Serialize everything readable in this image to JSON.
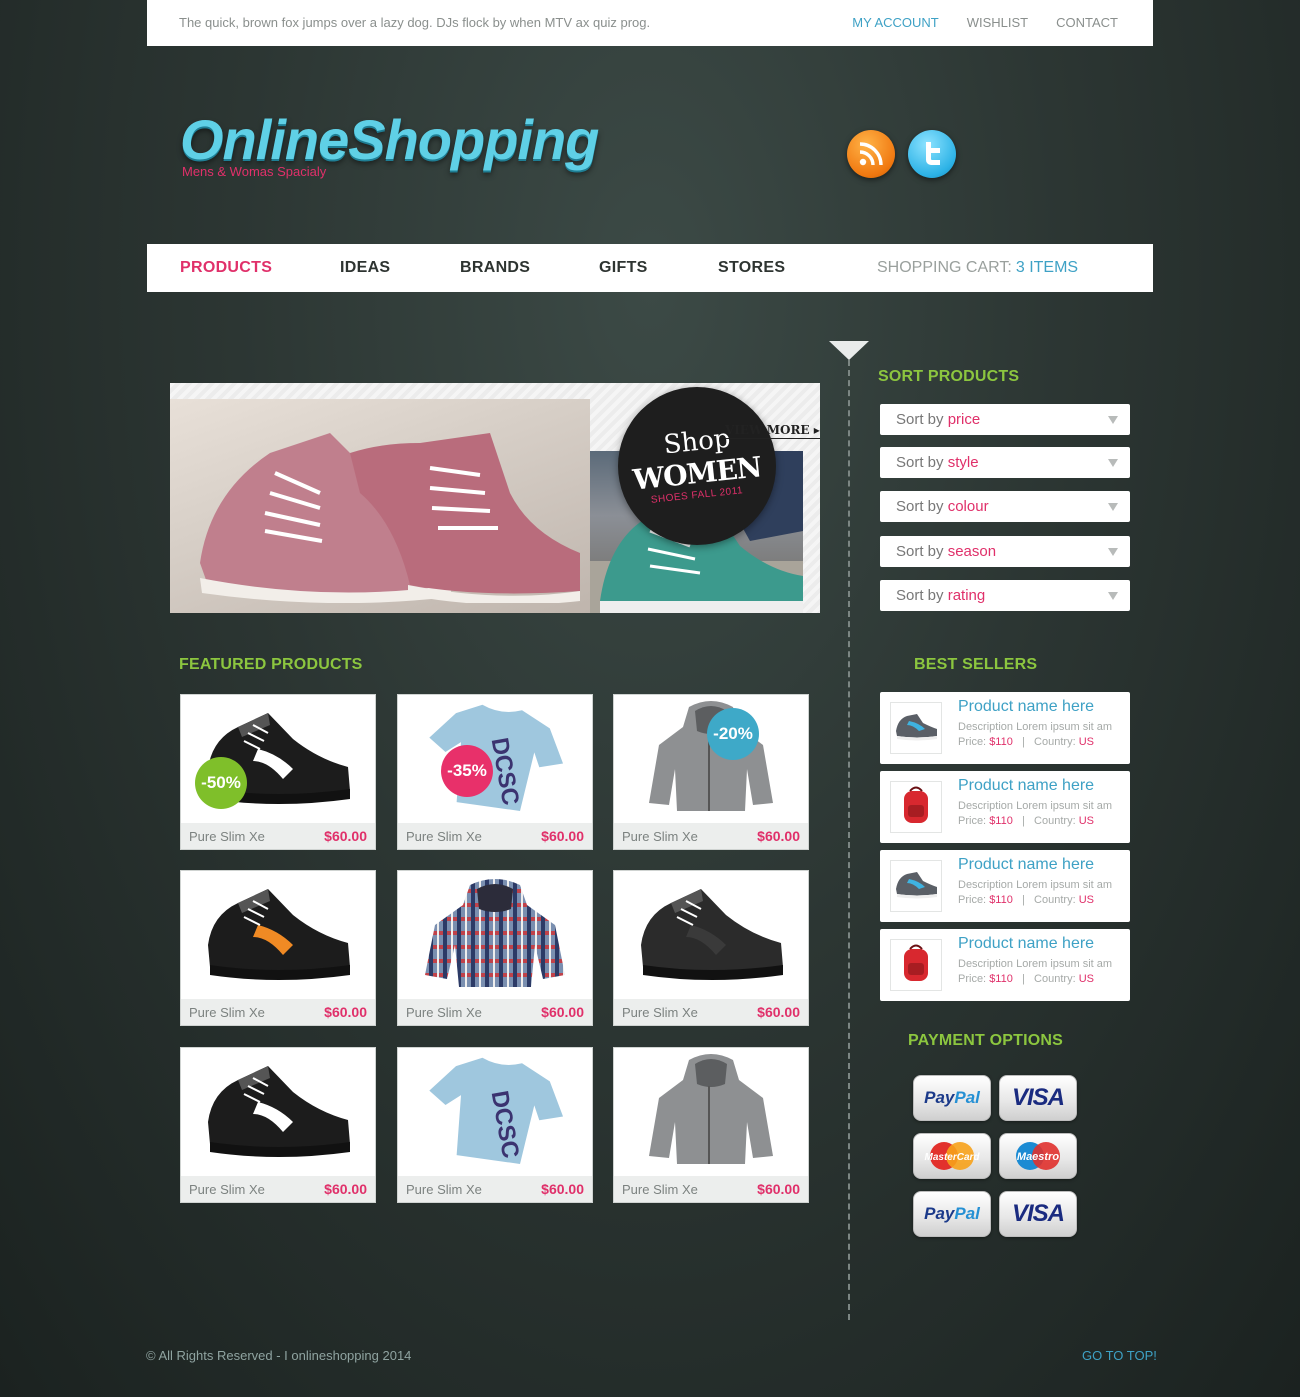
{
  "topbar": {
    "tagline": "The quick, brown fox jumps over a lazy dog. DJs flock by when MTV ax quiz prog.",
    "links": [
      "MY ACCOUNT",
      "WISHLIST",
      "CONTACT"
    ]
  },
  "logo": {
    "name": "OnlineShopping",
    "subtitle": "Mens & Womas Spacialy"
  },
  "nav": {
    "items": [
      "PRODUCTS",
      "IDEAS",
      "BRANDS",
      "GIFTS",
      "STORES"
    ],
    "cart_label": "SHOPPING CART:",
    "cart_count": "3 ITEMS"
  },
  "banner": {
    "line1": "Shop",
    "line2": "WOMEN",
    "line3": "SHOES FALL 2011",
    "view_more": "VIEW MORE"
  },
  "featured": {
    "title": "FEATURED PRODUCTS",
    "products": [
      {
        "name": "Pure Slim Xe",
        "price": "$60.00",
        "badge": "-50%",
        "icon": "sneaker-black-icon"
      },
      {
        "name": "Pure Slim Xe",
        "price": "$60.00",
        "badge": "-35%",
        "icon": "tshirt-blue-icon"
      },
      {
        "name": "Pure Slim Xe",
        "price": "$60.00",
        "badge": "-20%",
        "icon": "hoodie-grey-icon"
      },
      {
        "name": "Pure Slim Xe",
        "price": "$60.00",
        "icon": "sneaker-orange-icon"
      },
      {
        "name": "Pure Slim Xe",
        "price": "$60.00",
        "icon": "hoodie-plaid-icon"
      },
      {
        "name": "Pure Slim Xe",
        "price": "$60.00",
        "icon": "sneaker-dark-icon"
      },
      {
        "name": "Pure Slim Xe",
        "price": "$60.00",
        "icon": "sneaker-black-icon"
      },
      {
        "name": "Pure Slim Xe",
        "price": "$60.00",
        "icon": "tshirt-blue-icon"
      },
      {
        "name": "Pure Slim Xe",
        "price": "$60.00",
        "icon": "hoodie-grey-icon"
      }
    ],
    "badge_colors": {
      "-50%": "#7fbf2a",
      "-35%": "#e8306a",
      "-20%": "#3ea9c8"
    }
  },
  "sort": {
    "title": "SORT PRODUCTS",
    "prefix": "Sort by",
    "options": [
      "price",
      "style",
      "colour",
      "season",
      "rating"
    ]
  },
  "best_sellers": {
    "title": "BEST SELLERS",
    "items": [
      {
        "name": "Product name here",
        "desc": "Description Lorem ipsum sit am",
        "price_label": "Price:",
        "price": "$110",
        "country_label": "Country:",
        "country": "US",
        "icon": "sneaker-icon"
      },
      {
        "name": "Product name here",
        "desc": "Description Lorem ipsum sit am",
        "price_label": "Price:",
        "price": "$110",
        "country_label": "Country:",
        "country": "US",
        "icon": "backpack-icon"
      },
      {
        "name": "Product name here",
        "desc": "Description Lorem ipsum sit am",
        "price_label": "Price:",
        "price": "$110",
        "country_label": "Country:",
        "country": "US",
        "icon": "sneaker-icon"
      },
      {
        "name": "Product name here",
        "desc": "Description Lorem ipsum sit am",
        "price_label": "Price:",
        "price": "$110",
        "country_label": "Country:",
        "country": "US",
        "icon": "backpack-icon"
      }
    ]
  },
  "payment": {
    "title": "PAYMENT OPTIONS",
    "methods": [
      "PayPal",
      "VISA",
      "MasterCard",
      "Maestro",
      "PayPal",
      "VISA"
    ]
  },
  "footer": {
    "copyright": "© All Rights Reserved - I onlineshopping 2014",
    "go_top": "GO TO TOP!"
  },
  "colors": {
    "accent_pink": "#e0306a",
    "accent_blue": "#3ea1c5",
    "accent_green": "#8cc63f"
  }
}
